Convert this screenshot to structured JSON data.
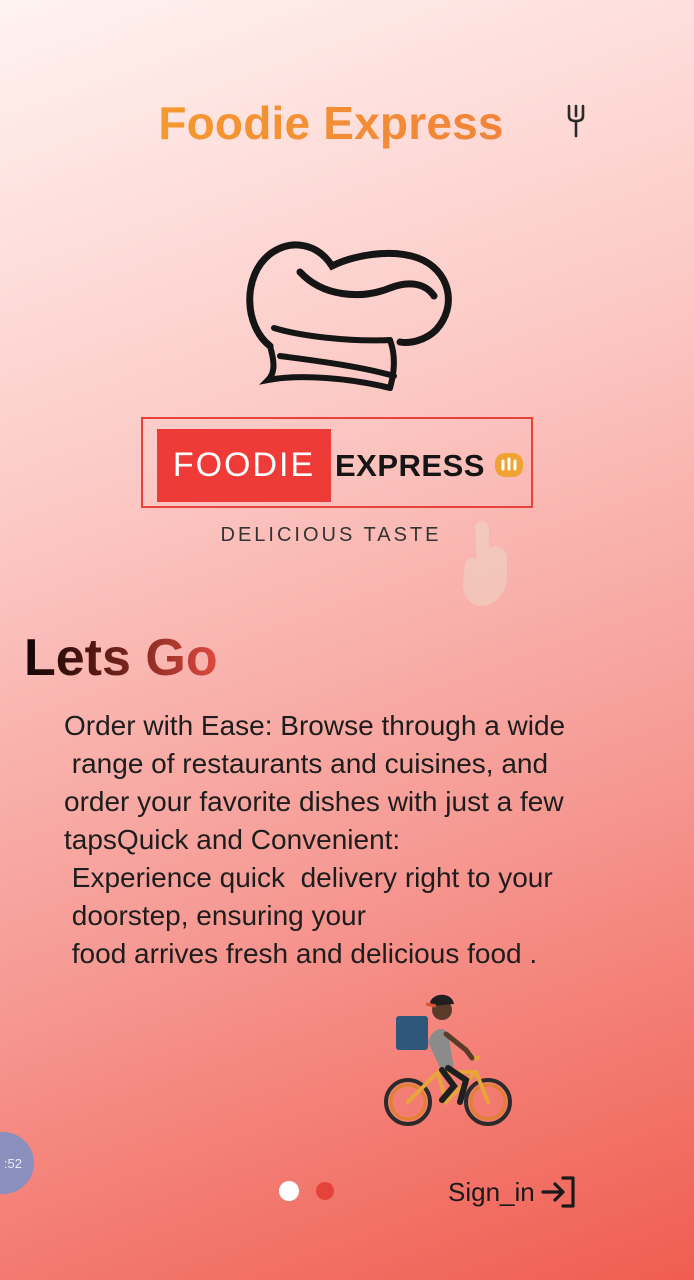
{
  "header": {
    "title": "Foodie Express",
    "action_icon": "fork-icon"
  },
  "logo": {
    "hat_icon": "chef-hat-icon",
    "brand_part1": "FOODIE",
    "brand_part2": "EXPRESS",
    "mark_icon": "chef-mark-icon",
    "tagline": "DELICIOUS TASTE"
  },
  "content": {
    "heading": "Lets Go",
    "description": "Order with Ease: Browse through a wide\n range of restaurants and cuisines, and\norder your favorite dishes with just a few\ntapsQuick and Convenient:\n Experience quick  delivery right to your\n doorstep, ensuring your\n food arrives fresh and delicious food .",
    "illustration": "delivery-bike-illustration"
  },
  "overlay": {
    "bubble_text": ":52"
  },
  "pagination": {
    "total": 2,
    "active": 1
  },
  "footer": {
    "signin_label": "Sign_in",
    "signin_icon": "login-arrow-icon"
  },
  "colors": {
    "title_start": "#f5a22b",
    "title_end": "#f07a3e",
    "brand_red": "#ef3b37",
    "dot_active": "#ffffff",
    "dot_inactive": "#e5433a"
  }
}
